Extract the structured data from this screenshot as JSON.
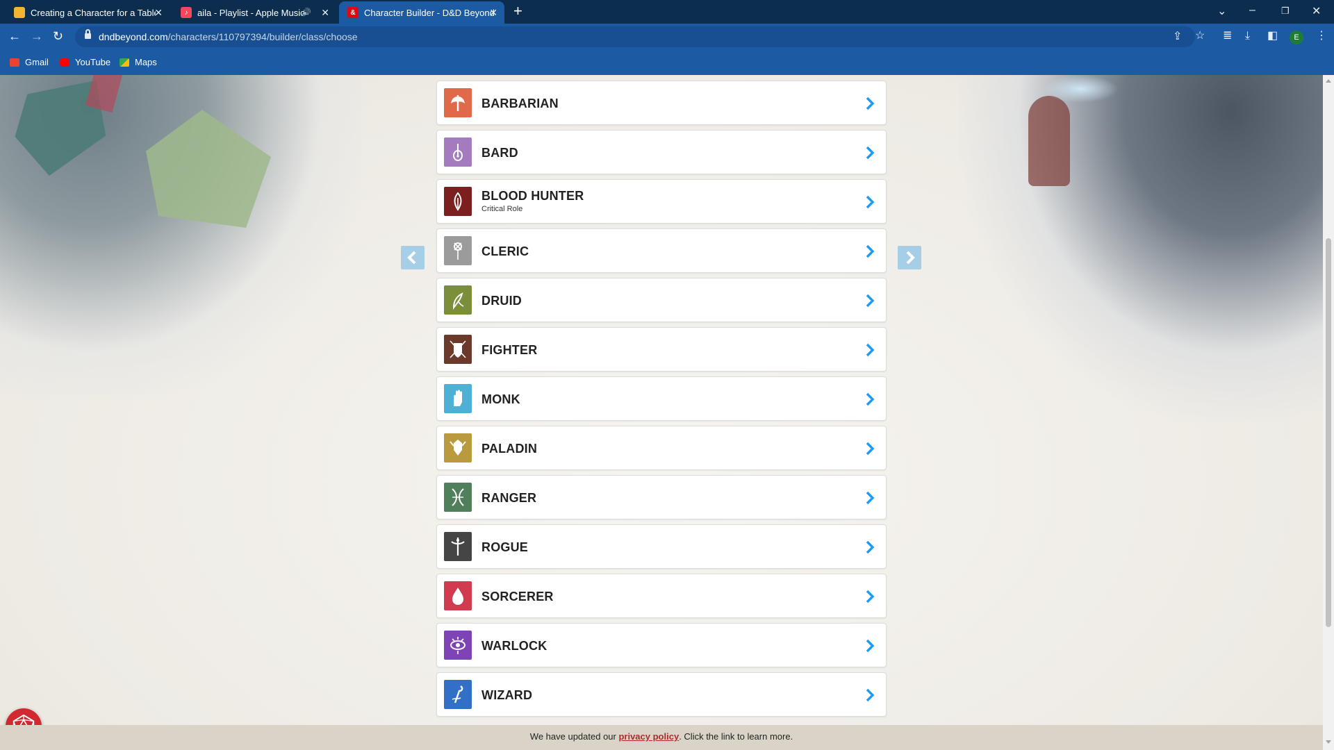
{
  "browser": {
    "tabs": [
      {
        "title": "Creating a Character for a Table",
        "favicon_color": "#f2b431"
      },
      {
        "title": "aila - Playlist - Apple Music",
        "favicon_color": "#f4475e",
        "audio": true
      },
      {
        "title": "Character Builder - D&D Beyond",
        "favicon_color": "#e40712",
        "active": true
      }
    ],
    "url_domain": "dndbeyond.com",
    "url_path": "/characters/110797394/builder/class/choose",
    "profile_initial": "E",
    "bookmarks": [
      {
        "label": "Gmail",
        "icon": "gmail-icon",
        "color": "#ea4335"
      },
      {
        "label": "YouTube",
        "icon": "youtube-icon",
        "color": "#ff0000"
      },
      {
        "label": "Maps",
        "icon": "maps-icon",
        "color": "#34a853"
      }
    ]
  },
  "classes": [
    {
      "name": "BARBARIAN",
      "color": "#e0694a",
      "icon": "barbarian-axe-icon"
    },
    {
      "name": "BARD",
      "color": "#a57bbf",
      "icon": "bard-lute-icon"
    },
    {
      "name": "BLOOD HUNTER",
      "sub": "Critical Role",
      "color": "#7b1f1f",
      "icon": "blood-hunter-icon"
    },
    {
      "name": "CLERIC",
      "color": "#9b9b9b",
      "icon": "cleric-mace-icon"
    },
    {
      "name": "DRUID",
      "color": "#7b8f3a",
      "icon": "druid-leaf-icon"
    },
    {
      "name": "FIGHTER",
      "color": "#6b3a2a",
      "icon": "fighter-shield-icon"
    },
    {
      "name": "MONK",
      "color": "#4fb0d6",
      "icon": "monk-fist-icon"
    },
    {
      "name": "PALADIN",
      "color": "#b99a3e",
      "icon": "paladin-helm-icon"
    },
    {
      "name": "RANGER",
      "color": "#4f7f5b",
      "icon": "ranger-bow-icon"
    },
    {
      "name": "ROGUE",
      "color": "#454545",
      "icon": "rogue-dagger-icon"
    },
    {
      "name": "SORCERER",
      "color": "#d13a4f",
      "icon": "sorcerer-flame-icon"
    },
    {
      "name": "WARLOCK",
      "color": "#7e44b5",
      "icon": "warlock-eye-icon"
    },
    {
      "name": "WIZARD",
      "color": "#3270c8",
      "icon": "wizard-staff-icon"
    }
  ],
  "accent_color": "#1b9af7",
  "notice": {
    "prefix": "We have updated our ",
    "link": "privacy policy",
    "suffix": ". Click the link to learn more."
  }
}
